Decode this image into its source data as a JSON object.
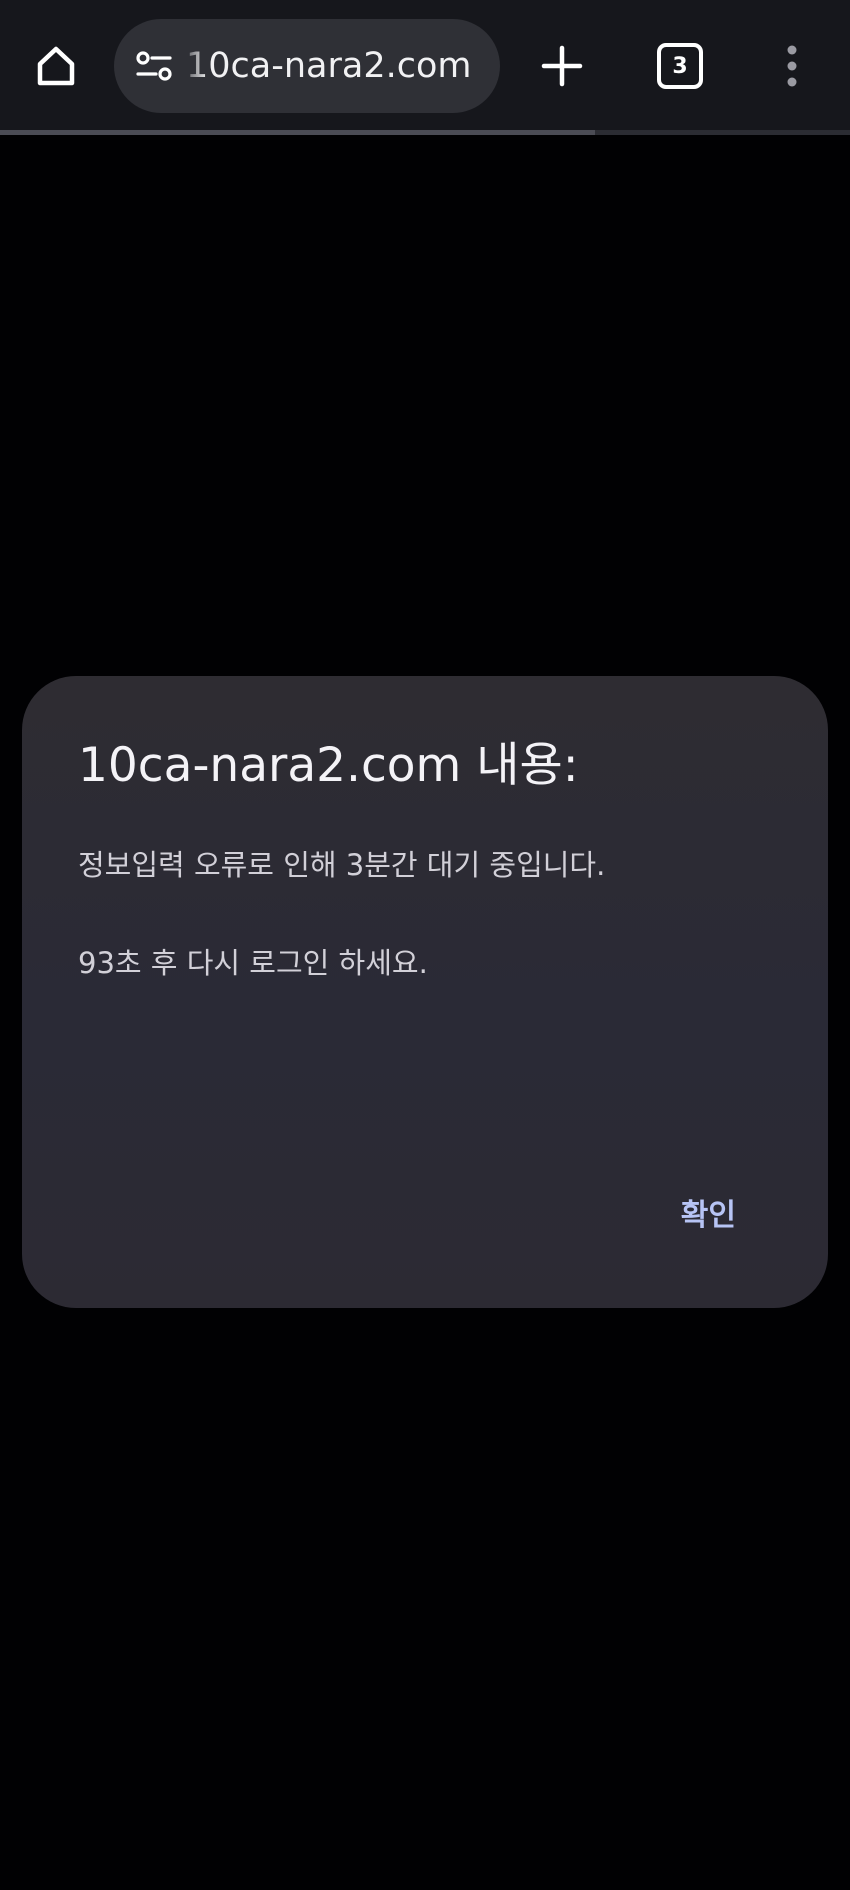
{
  "browser": {
    "url": "10ca-nara2.com",
    "tab_count": "3",
    "load_progress": 0.7,
    "icons": {
      "home": "home-icon",
      "site_settings": "tune-icon",
      "new_tab": "plus-icon",
      "tabs": "tab-switcher-icon",
      "menu": "more-vert-icon"
    }
  },
  "dialog": {
    "title": "10ca-nara2.com 내용:",
    "message_line1": "정보입력 오류로 인해 3분간 대기 중입니다.",
    "message_line2": "93초 후 다시 로그인 하세요.",
    "ok_label": "확인"
  },
  "colors": {
    "toolbar_bg": "#16171c",
    "page_bg": "#010103",
    "dialog_bg": "#2c2b34",
    "accent": "#b7c4f5"
  }
}
